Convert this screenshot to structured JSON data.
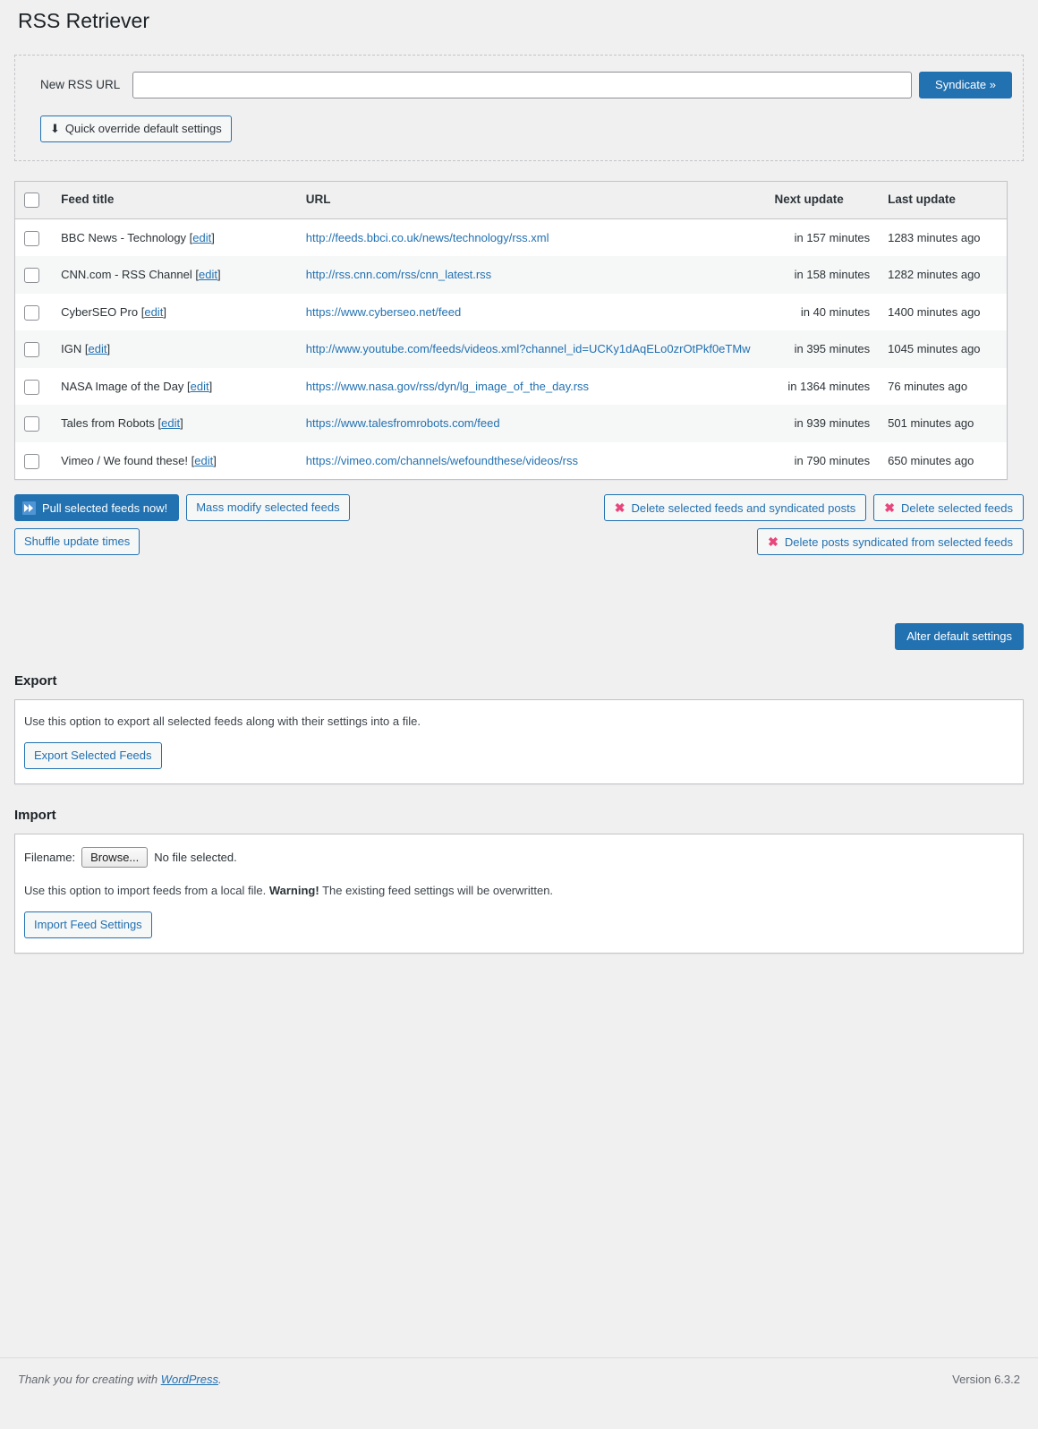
{
  "page": {
    "title": "RSS Retriever"
  },
  "add_feed": {
    "label": "New RSS URL",
    "input_value": "",
    "input_placeholder": "",
    "syndicate_label": "Syndicate »",
    "quick_override_label": "Quick override default settings",
    "quick_override_icon": "down-arrow-icon",
    "quick_override_glyph": "⬇"
  },
  "table": {
    "columns": [
      "Feed title",
      "URL",
      "Next update",
      "Last update"
    ],
    "edit_label": "edit",
    "rows": [
      {
        "title": "BBC News - Technology",
        "url": "http://feeds.bbci.co.uk/news/technology/rss.xml",
        "next_update": "in 157 minutes",
        "last_update": "1283 minutes ago"
      },
      {
        "title": "CNN.com - RSS Channel",
        "url": "http://rss.cnn.com/rss/cnn_latest.rss",
        "next_update": "in 158 minutes",
        "last_update": "1282 minutes ago"
      },
      {
        "title": "CyberSEO Pro",
        "url": "https://www.cyberseo.net/feed",
        "next_update": "in 40 minutes",
        "last_update": "1400 minutes ago"
      },
      {
        "title": "IGN",
        "url": "http://www.youtube.com/feeds/videos.xml?channel_id=UCKy1dAqELo0zrOtPkf0eTMw",
        "next_update": "in 395 minutes",
        "last_update": "1045 minutes ago"
      },
      {
        "title": "NASA Image of the Day",
        "url": "https://www.nasa.gov/rss/dyn/lg_image_of_the_day.rss",
        "next_update": "in 1364 minutes",
        "last_update": "76 minutes ago"
      },
      {
        "title": "Tales from Robots",
        "url": "https://www.talesfromrobots.com/feed",
        "next_update": "in 939 minutes",
        "last_update": "501 minutes ago"
      },
      {
        "title": "Vimeo / We found these!",
        "url": "https://vimeo.com/channels/wefoundthese/videos/rss",
        "next_update": "in 790 minutes",
        "last_update": "650 minutes ago"
      }
    ]
  },
  "actions": {
    "pull_label": "Pull selected feeds now!",
    "pull_icon": "fast-forward-icon",
    "pull_glyph": "▶▶",
    "mass_modify_label": "Mass modify selected feeds",
    "shuffle_label": "Shuffle update times",
    "delete_feeds_and_posts_label": "Delete selected feeds and syndicated posts",
    "delete_feeds_label": "Delete selected feeds",
    "delete_posts_label": "Delete posts syndicated from selected feeds",
    "delete_icon": "x-mark-icon",
    "delete_glyph": "✖",
    "alter_defaults_label": "Alter default settings"
  },
  "export": {
    "heading": "Export",
    "description": "Use this option to export all selected feeds along with their settings into a file.",
    "button_label": "Export Selected Feeds"
  },
  "import": {
    "heading": "Import",
    "filename_label": "Filename:",
    "browse_label": "Browse...",
    "no_file_text": "No file selected.",
    "description_before": "Use this option to import feeds from a local file. ",
    "description_warning": "Warning!",
    "description_after": " The existing feed settings will be overwritten.",
    "button_label": "Import Feed Settings"
  },
  "footer": {
    "thanks_before": "Thank you for creating with ",
    "link_text": "WordPress",
    "thanks_after": ".",
    "version": "Version 6.3.2"
  },
  "colors": {
    "accent": "#2271b1",
    "danger": "#e8467c",
    "background": "#f0f0f1",
    "border": "#c3c4c7"
  }
}
